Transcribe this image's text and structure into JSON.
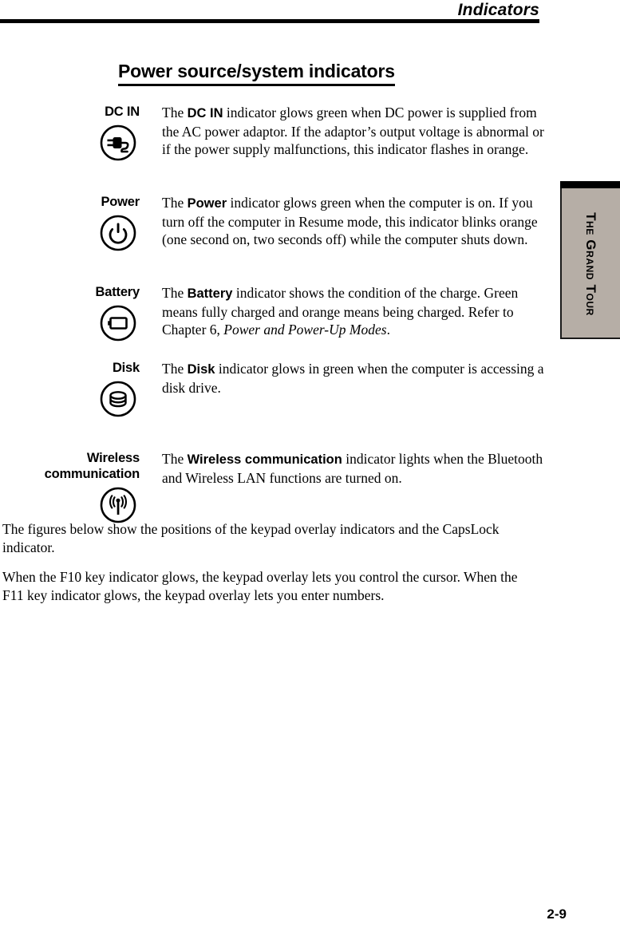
{
  "header": {
    "running_head": "Indicators"
  },
  "section": {
    "title": "Power source/system indicators"
  },
  "indicators": [
    {
      "label": "DC IN",
      "icon": "dc-in-plug-icon",
      "text_prefix": "The ",
      "text_bold": "DC IN",
      "text_suffix": " indicator glows green when DC power is supplied from the AC power adaptor. If the adaptor’s output voltage is abnormal or if the power supply malfunctions, this indicator flashes in orange."
    },
    {
      "label": "Power",
      "icon": "power-symbol-icon",
      "text_prefix": "The ",
      "text_bold": "Power",
      "text_suffix": " indicator glows green when the computer is on. If you turn off the computer in Resume mode, this indicator blinks orange (one second on, two seconds off) while the computer shuts down."
    },
    {
      "label": "Battery",
      "icon": "battery-icon",
      "text_prefix": "The ",
      "text_bold": "Battery",
      "text_suffix": " indicator shows the condition of the charge. Green means fully charged and orange means being charged. Refer to Chapter 6, ",
      "text_italic": "Power and Power-Up Modes",
      "text_tail": "."
    },
    {
      "label": "Disk",
      "icon": "disk-stack-icon",
      "text_prefix": "The ",
      "text_bold": "Disk",
      "text_suffix": " indicator glows in green when the computer is accessing a disk drive."
    },
    {
      "label": "Wireless communication",
      "label_line1": "Wireless",
      "label_line2": "communication",
      "icon": "wireless-antenna-icon",
      "text_prefix": "The ",
      "text_bold": "Wireless communication",
      "text_suffix": " indicator lights when the Bluetooth and Wireless LAN functions are turned on."
    }
  ],
  "body_paragraphs": [
    "The figures below show the positions of the keypad overlay indicators and the CapsLock indicator.",
    "When the F10 key indicator glows, the keypad overlay lets you control the cursor. When the F11 key indicator glows, the keypad overlay lets you enter numbers."
  ],
  "chapter_tab": {
    "label": "The Grand Tour",
    "background_color": "#b6aea6",
    "bar_color": "#000000"
  },
  "footer": {
    "page_number": "2-9"
  }
}
